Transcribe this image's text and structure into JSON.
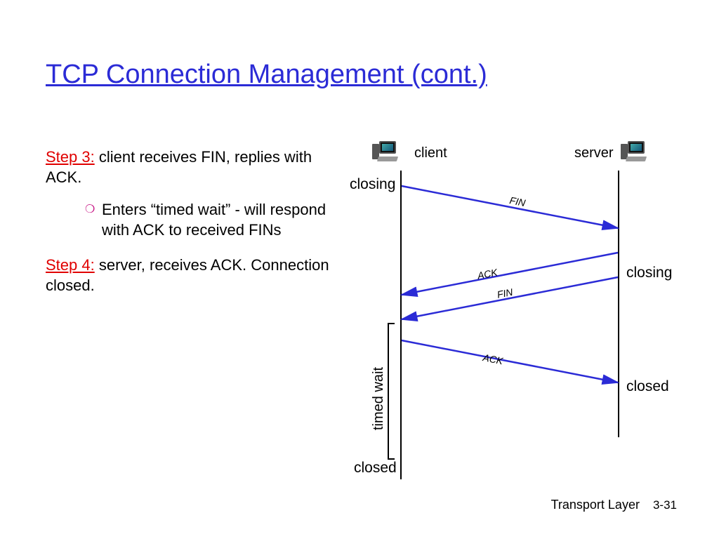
{
  "title": "TCP Connection Management (cont.)",
  "step3": {
    "label": "Step 3:",
    "keyword": "client",
    "rest": " receives FIN, replies with ACK.",
    "sub": "Enters “timed wait” - will respond with ACK to received FINs"
  },
  "step4": {
    "label": "Step 4:",
    "keyword": "server",
    "rest": ", receives ACK.  Connection closed."
  },
  "diagram": {
    "client_label": "client",
    "server_label": "server",
    "states": {
      "client_closing": "closing",
      "server_closing": "closing",
      "server_closed": "closed",
      "client_closed": "closed",
      "timed_wait": "timed wait"
    },
    "messages": {
      "fin1": "FIN",
      "ack1": "ACK",
      "fin2": "FIN",
      "ack2": "ACK"
    }
  },
  "footer": {
    "section": "Transport Layer",
    "page": "3-31"
  },
  "colors": {
    "title": "#2b2bd6",
    "step": "#e00000",
    "arrow": "#2b2bd6"
  }
}
